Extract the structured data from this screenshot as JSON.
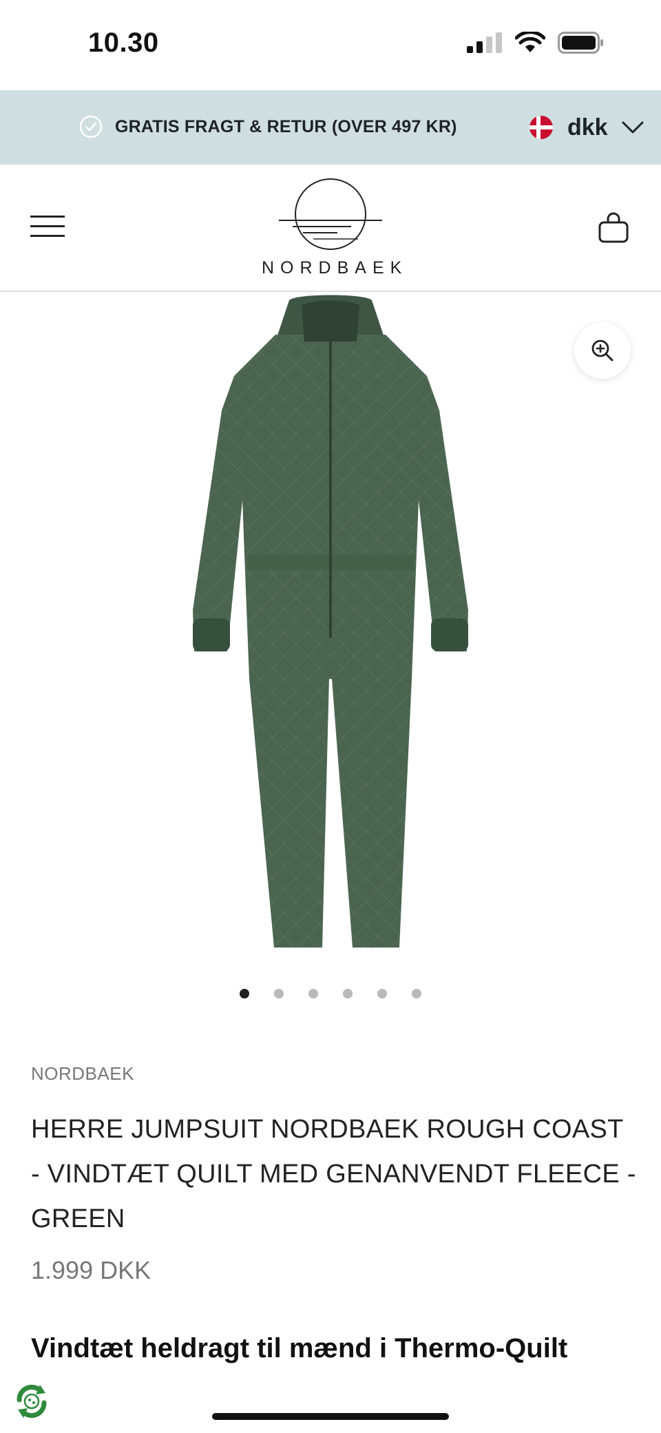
{
  "status_bar": {
    "time": "10.30"
  },
  "promo_bar": {
    "text": "GRATIS FRAGT & RETUR (OVER 497 KR)",
    "currency": "dkk"
  },
  "header": {
    "logo_text": "NORDBAEK"
  },
  "gallery": {
    "dot_count": 6,
    "active_index": 0
  },
  "product": {
    "vendor": "NORDBAEK",
    "title": "HERRE JUMPSUIT NORDBAEK ROUGH COAST - VINDTÆT QUILT MED GENANVENDT FLEECE - GREEN",
    "price": "1.999 DKK",
    "color": "#4b6450"
  },
  "description": {
    "heading": "Vindtæt heldragt til mænd i Thermo-Quilt"
  },
  "icons": {
    "promo": "check-circle-icon",
    "currency": "denmark-flag-icon",
    "menu": "hamburger-menu-icon",
    "cart": "shopping-bag-icon",
    "zoom": "zoom-in-icon",
    "badge": "recycle-badge-icon"
  },
  "colors": {
    "promo_bar": "#cfdee1",
    "accent": "#1d2326",
    "price": "#777777"
  }
}
